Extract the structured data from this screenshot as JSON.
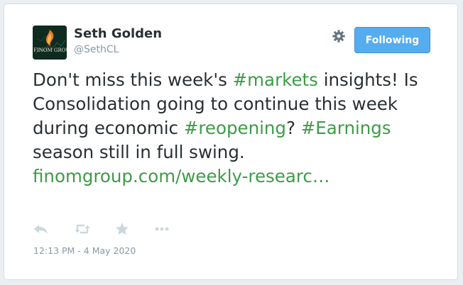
{
  "user": {
    "name": "Seth Golden",
    "handle": "@SethCL",
    "avatar_label": "FINOM GROUP"
  },
  "follow_button": {
    "label": "Following"
  },
  "tweet": {
    "segments": [
      {
        "text": "Don't miss this week's ",
        "link": false
      },
      {
        "text": "#markets",
        "link": true
      },
      {
        "text": " insights! Is Consolidation going to continue this week during economic ",
        "link": false
      },
      {
        "text": "#reopening",
        "link": true
      },
      {
        "text": "? ",
        "link": false
      },
      {
        "text": "#Earnings",
        "link": true
      },
      {
        "text": " season still in full swing. ",
        "link": false
      },
      {
        "text": "finomgroup.com/weekly-researc…",
        "link": true
      }
    ],
    "timestamp": "12:13 PM - 4 May 2020"
  },
  "actions": [
    "reply-icon",
    "retweet-icon",
    "favorite-icon",
    "more-icon"
  ],
  "colors": {
    "link": "#3e9b48",
    "follow_button": "#55acee",
    "text": "#292f33",
    "muted": "#8899a6",
    "action_icon": "#ccd6dd"
  }
}
